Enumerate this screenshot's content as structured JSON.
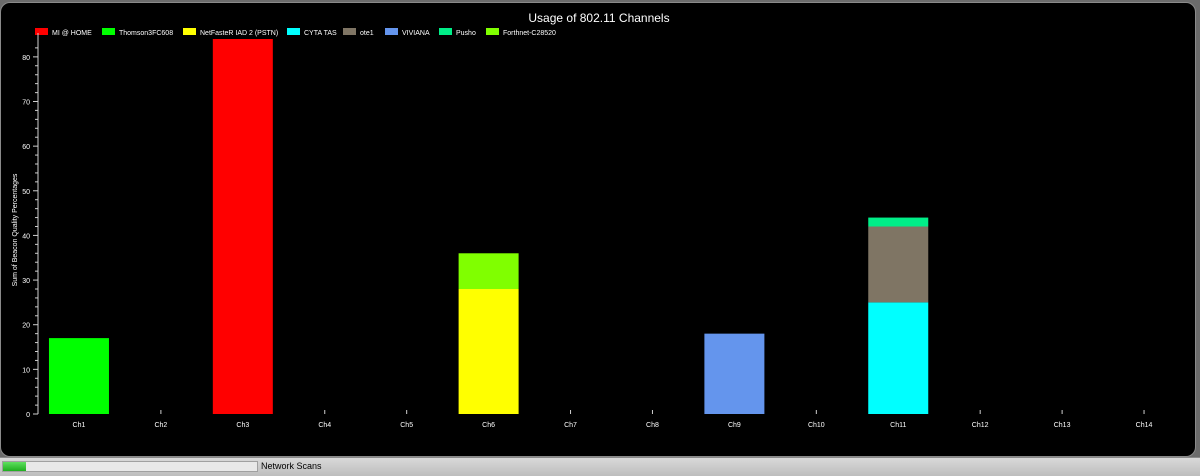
{
  "chart_data": {
    "type": "bar",
    "stacked": true,
    "title": "Usage of 802.11 Channels",
    "xlabel": "",
    "ylabel": "Sum of Beacon Quality Percentages",
    "ylim": [
      0,
      84
    ],
    "yticks": [
      0,
      10,
      20,
      30,
      40,
      50,
      60,
      70,
      80
    ],
    "grid": false,
    "legend_position": "top-left",
    "categories": [
      "Ch1",
      "Ch2",
      "Ch3",
      "Ch4",
      "Ch5",
      "Ch6",
      "Ch7",
      "Ch8",
      "Ch9",
      "Ch10",
      "Ch11",
      "Ch12",
      "Ch13",
      "Ch14"
    ],
    "series": [
      {
        "name": "MI @ HOME",
        "color": "#ff0000",
        "values": [
          0,
          0,
          84,
          0,
          0,
          0,
          0,
          0,
          0,
          0,
          0,
          0,
          0,
          0
        ]
      },
      {
        "name": "Thomson3FC608",
        "color": "#00ff00",
        "values": [
          17,
          0,
          0,
          0,
          0,
          0,
          0,
          0,
          0,
          0,
          0,
          0,
          0,
          0
        ]
      },
      {
        "name": "NetFasteR IAD 2 (PSTN)",
        "color": "#ffff00",
        "values": [
          0,
          0,
          0,
          0,
          0,
          28,
          0,
          0,
          0,
          0,
          0,
          0,
          0,
          0
        ]
      },
      {
        "name": "CYTA TAS",
        "color": "#00ffff",
        "values": [
          0,
          0,
          0,
          0,
          0,
          0,
          0,
          0,
          0,
          0,
          25,
          0,
          0,
          0
        ]
      },
      {
        "name": "ote1",
        "color": "#7f7564",
        "values": [
          0,
          0,
          0,
          0,
          0,
          0,
          0,
          0,
          0,
          0,
          17,
          0,
          0,
          0
        ]
      },
      {
        "name": "VIVIANA",
        "color": "#6495ed",
        "values": [
          0,
          0,
          0,
          0,
          0,
          0,
          0,
          0,
          18,
          0,
          0,
          0,
          0,
          0
        ]
      },
      {
        "name": "Pusho",
        "color": "#00ee88",
        "values": [
          0,
          0,
          0,
          0,
          0,
          0,
          0,
          0,
          0,
          0,
          2,
          0,
          0,
          0
        ]
      },
      {
        "name": "Forthnet-C28520",
        "color": "#80ff00",
        "values": [
          0,
          0,
          0,
          0,
          0,
          8,
          0,
          0,
          0,
          0,
          0,
          0,
          0,
          0
        ]
      }
    ]
  },
  "status": {
    "label": "Network Scans",
    "progress": 0.09
  }
}
